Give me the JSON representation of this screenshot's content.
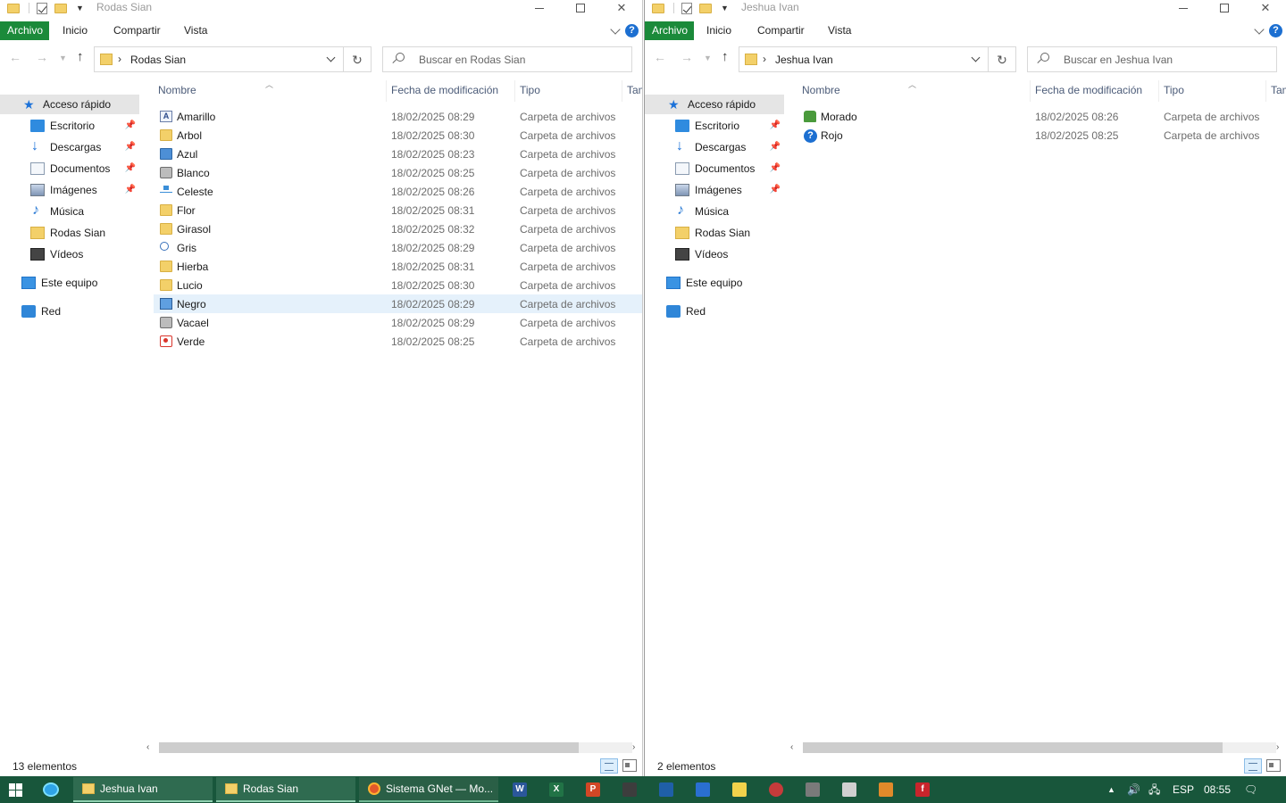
{
  "left_window": {
    "title": "Rodas Sian",
    "ribbon_tabs": [
      "Archivo",
      "Inicio",
      "Compartir",
      "Vista"
    ],
    "address_path": "Rodas Sian",
    "search_placeholder": "Buscar en Rodas Sian",
    "columns": [
      "Nombre",
      "Fecha de modificación",
      "Tipo",
      "Tam"
    ],
    "files": [
      {
        "name": "Amarillo",
        "date": "18/02/2025 08:29",
        "type": "Carpeta de archivos",
        "icon": "text-file-icon"
      },
      {
        "name": "Arbol",
        "date": "18/02/2025 08:30",
        "type": "Carpeta de archivos",
        "icon": "folder-icon"
      },
      {
        "name": "Azul",
        "date": "18/02/2025 08:23",
        "type": "Carpeta de archivos",
        "icon": "monitor-icon"
      },
      {
        "name": "Blanco",
        "date": "18/02/2025 08:25",
        "type": "Carpeta de archivos",
        "icon": "drive-icon"
      },
      {
        "name": "Celeste",
        "date": "18/02/2025 08:26",
        "type": "Carpeta de archivos",
        "icon": "network-icon"
      },
      {
        "name": "Flor",
        "date": "18/02/2025 08:31",
        "type": "Carpeta de archivos",
        "icon": "folder-icon"
      },
      {
        "name": "Girasol",
        "date": "18/02/2025 08:32",
        "type": "Carpeta de archivos",
        "icon": "folder-icon"
      },
      {
        "name": "Gris",
        "date": "18/02/2025 08:29",
        "type": "Carpeta de archivos",
        "icon": "search-icon"
      },
      {
        "name": "Hierba",
        "date": "18/02/2025 08:31",
        "type": "Carpeta de archivos",
        "icon": "folder-icon"
      },
      {
        "name": "Lucio",
        "date": "18/02/2025 08:30",
        "type": "Carpeta de archivos",
        "icon": "folder-icon"
      },
      {
        "name": "Negro",
        "date": "18/02/2025 08:29",
        "type": "Carpeta de archivos",
        "icon": "tv-icon",
        "selected": true
      },
      {
        "name": "Vacael",
        "date": "18/02/2025 08:29",
        "type": "Carpeta de archivos",
        "icon": "pc-icon"
      },
      {
        "name": "Verde",
        "date": "18/02/2025 08:25",
        "type": "Carpeta de archivos",
        "icon": "red-target-icon"
      }
    ],
    "status_count": "13 elementos"
  },
  "right_window": {
    "title": "Jeshua Ivan",
    "ribbon_tabs": [
      "Archivo",
      "Inicio",
      "Compartir",
      "Vista"
    ],
    "address_path": "Jeshua Ivan",
    "search_placeholder": "Buscar en Jeshua Ivan",
    "columns": [
      "Nombre",
      "Fecha de modificación",
      "Tipo",
      "Tam"
    ],
    "files": [
      {
        "name": "Morado",
        "date": "18/02/2025 08:26",
        "type": "Carpeta de archivos",
        "icon": "green-people-icon"
      },
      {
        "name": "Rojo",
        "date": "18/02/2025 08:25",
        "type": "Carpeta de archivos",
        "icon": "question-icon"
      }
    ],
    "status_count": "2 elementos"
  },
  "sidebar": {
    "quick_access": "Acceso rápido",
    "items": [
      {
        "label": "Escritorio",
        "icon": "desktop-icon",
        "pinned": true
      },
      {
        "label": "Descargas",
        "icon": "download-icon",
        "pinned": true
      },
      {
        "label": "Documentos",
        "icon": "documents-icon",
        "pinned": true
      },
      {
        "label": "Imágenes",
        "icon": "pictures-icon",
        "pinned": true
      },
      {
        "label": "Música",
        "icon": "music-icon",
        "pinned": false
      },
      {
        "label": "Rodas Sian",
        "icon": "folder-icon",
        "pinned": false
      },
      {
        "label": "Vídeos",
        "icon": "videos-icon",
        "pinned": false
      }
    ],
    "this_pc": "Este equipo",
    "network": "Red"
  },
  "taskbar": {
    "windows": [
      {
        "label": "Jeshua Ivan",
        "icon": "folder-icon"
      },
      {
        "label": "Rodas Sian",
        "icon": "folder-icon"
      },
      {
        "label": "Sistema GNet — Mo...",
        "icon": "firefox-icon"
      }
    ],
    "pinned_apps": [
      "word-icon",
      "excel-icon",
      "powerpoint-icon",
      "app-icon",
      "app-icon",
      "app-icon",
      "notes-icon",
      "app-icon",
      "app-icon",
      "app-icon",
      "app-icon",
      "app-icon"
    ],
    "language": "ESP",
    "time": "08:55"
  },
  "colors": {
    "ribbon_file_tab": "#1b8a3a",
    "taskbar": "#18563b",
    "selection": "#e5f1fb"
  }
}
